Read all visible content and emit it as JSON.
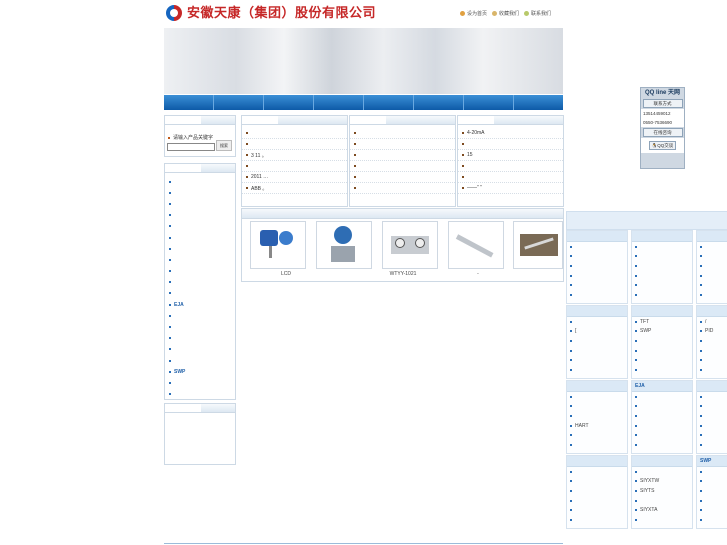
{
  "header": {
    "company_name": "安徽天康（集团）股份有限公司",
    "links": [
      {
        "label": "设为首页",
        "icon": "home-icon"
      },
      {
        "label": "收藏我们",
        "icon": "favorite-icon"
      },
      {
        "label": "联系我们",
        "icon": "contact-icon"
      }
    ]
  },
  "search": {
    "prompt": "请输入产品关键字",
    "value": "",
    "button_label": "搜索"
  },
  "news_columns": [
    {
      "items": [
        "",
        "",
        "3 11       。",
        "",
        "       2011  …",
        "ABB         。"
      ]
    },
    {
      "items": [
        "",
        "",
        "",
        "",
        "",
        ""
      ]
    },
    {
      "items": [
        "4-20mA",
        "",
        "         15",
        "",
        "",
        "     ——”  ”"
      ]
    }
  ],
  "left_categories": [
    "",
    "",
    "",
    "",
    "",
    "",
    "",
    "",
    "",
    "",
    "",
    "EJA",
    "",
    "",
    "",
    "",
    "",
    "SWP",
    "",
    ""
  ],
  "products": [
    {
      "label": "LCD"
    },
    {
      "label": ""
    },
    {
      "label": "WTYY-1021"
    },
    {
      "label": "-"
    },
    {
      "label": ""
    }
  ],
  "qq_widget": {
    "title": "QQ line 天网",
    "contact_label": "联系方式",
    "phone1": "13514459012",
    "phone2": "0550-7536690",
    "online_label": "在线咨询",
    "chat_label": "QQ交谈"
  },
  "right_grid": {
    "col1": [
      {
        "title": "",
        "items": [
          "",
          "",
          "",
          "",
          "",
          ""
        ]
      },
      {
        "title": "",
        "items": [
          "",
          "[",
          "",
          "",
          "",
          ""
        ]
      },
      {
        "title": "",
        "items": [
          "",
          "",
          "",
          "HART",
          "",
          ""
        ]
      },
      {
        "title": "",
        "items": [
          "",
          "",
          "",
          "",
          "",
          ""
        ]
      }
    ],
    "col2": [
      {
        "title": "",
        "items": [
          "",
          "",
          "",
          "",
          "",
          ""
        ]
      },
      {
        "title": "",
        "items": [
          "TFT",
          "SWP",
          "",
          "",
          "",
          ""
        ]
      },
      {
        "title": "EJA",
        "items": [
          "",
          "",
          "",
          "",
          "",
          ""
        ]
      },
      {
        "title": "",
        "items": [
          "",
          "SIYXTW",
          "SIYTS",
          "",
          "SIYXTA",
          ""
        ]
      }
    ],
    "col3": [
      {
        "title": "",
        "items": [
          "",
          "",
          "",
          "",
          "",
          ""
        ]
      },
      {
        "title": "",
        "items": [
          "/",
          "PID",
          "",
          "",
          "",
          ""
        ]
      },
      {
        "title": "",
        "items": [
          "",
          "",
          "",
          "",
          "",
          ""
        ]
      },
      {
        "title": "SWP",
        "items": [
          "",
          "",
          "",
          "",
          "",
          ""
        ]
      }
    ]
  }
}
